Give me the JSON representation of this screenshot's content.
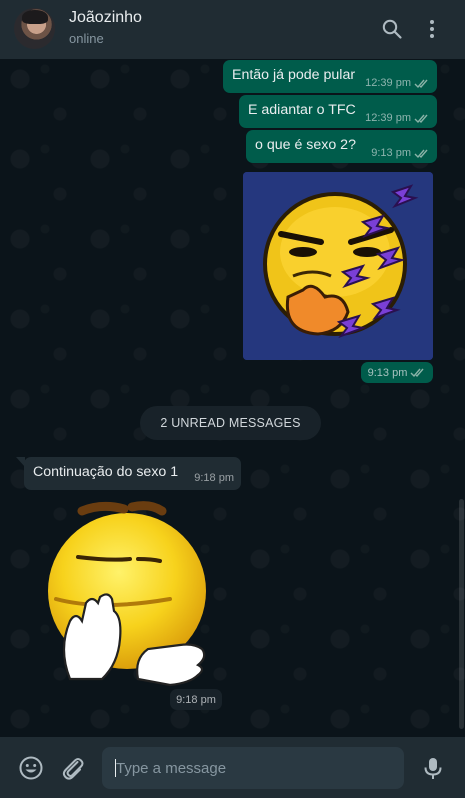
{
  "header": {
    "contact_name": "Joãozinho",
    "status": "online",
    "icons": [
      "search-icon",
      "menu-icon"
    ]
  },
  "messages": [
    {
      "direction": "out",
      "text": "Então já pode pular",
      "time": "12:39 pm",
      "status": "read"
    },
    {
      "direction": "out",
      "text": "E adiantar o TFC",
      "time": "12:39 pm",
      "status": "read"
    },
    {
      "direction": "out",
      "text": "o que é sexo 2?",
      "time": "9:13 pm",
      "status": "read"
    },
    {
      "direction": "out",
      "type": "sticker",
      "time": "9:13 pm",
      "status": "read"
    },
    {
      "direction": "in",
      "text": "Continuação do sexo 1",
      "time": "9:18 pm"
    },
    {
      "direction": "in",
      "type": "sticker",
      "time": "9:18 pm"
    }
  ],
  "unread_banner": "2 UNREAD MESSAGES",
  "composer": {
    "placeholder": "Type a message",
    "icons": [
      "emoji-icon",
      "attach-icon",
      "mic-icon"
    ]
  },
  "colors": {
    "header_bg": "#202c33",
    "chat_bg": "#0b141a",
    "outgoing_bubble": "#005c4b",
    "incoming_bubble": "#202c33",
    "read_ticks": "#53bdeb"
  }
}
